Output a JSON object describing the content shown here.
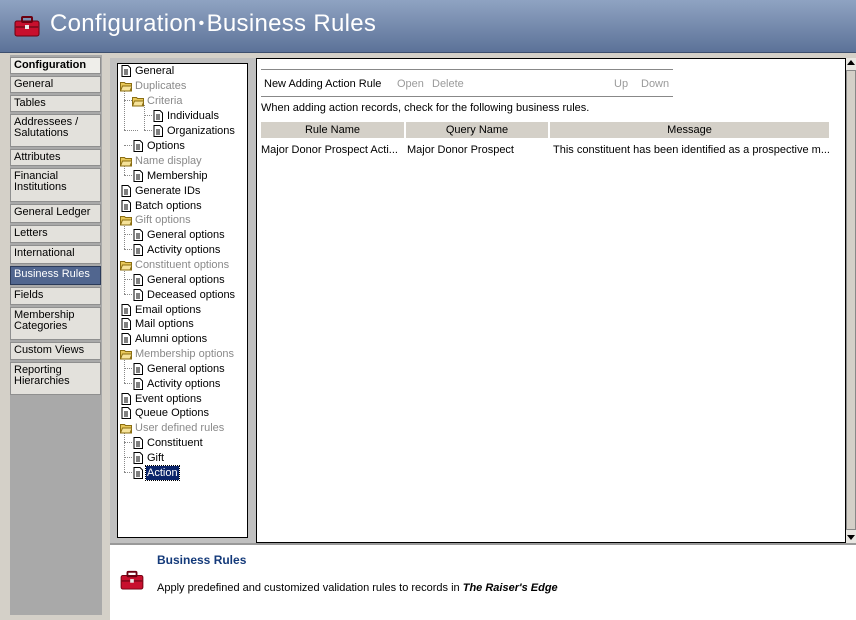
{
  "header": {
    "title_main": "Configuration",
    "separator": "•",
    "title_sub": "Business Rules",
    "icon": "toolbox-icon"
  },
  "nav": {
    "header_label": "Configuration",
    "items": [
      {
        "label": "General"
      },
      {
        "label": "Tables"
      },
      {
        "label": "Addressees / Salutations"
      },
      {
        "label": "Attributes"
      },
      {
        "label": "Financial Institutions"
      },
      {
        "label": "General Ledger"
      },
      {
        "label": "Letters"
      },
      {
        "label": "International"
      },
      {
        "label": "Business Rules",
        "active": true
      },
      {
        "label": "Fields"
      },
      {
        "label": "Membership Categories"
      },
      {
        "label": "Custom Views"
      },
      {
        "label": "Reporting Hierarchies"
      }
    ]
  },
  "tree": {
    "nodes": [
      {
        "label": "General",
        "icon": "page-icon"
      },
      {
        "label": "Duplicates",
        "icon": "folder-open-icon"
      },
      {
        "label": "Criteria",
        "icon": "folder-open-icon"
      },
      {
        "label": "Individuals",
        "icon": "page-icon"
      },
      {
        "label": "Organizations",
        "icon": "page-icon"
      },
      {
        "label": "Options",
        "icon": "page-icon"
      },
      {
        "label": "Name display",
        "icon": "folder-open-icon"
      },
      {
        "label": "Membership",
        "icon": "page-icon"
      },
      {
        "label": "Generate IDs",
        "icon": "page-icon"
      },
      {
        "label": "Batch options",
        "icon": "page-icon"
      },
      {
        "label": "Gift options",
        "icon": "folder-open-icon"
      },
      {
        "label": "General options",
        "icon": "page-icon"
      },
      {
        "label": "Activity options",
        "icon": "page-icon"
      },
      {
        "label": "Constituent options",
        "icon": "folder-open-icon"
      },
      {
        "label": "General options",
        "icon": "page-icon"
      },
      {
        "label": "Deceased options",
        "icon": "page-icon"
      },
      {
        "label": "Email options",
        "icon": "page-icon"
      },
      {
        "label": "Mail options",
        "icon": "page-icon"
      },
      {
        "label": "Alumni options",
        "icon": "page-icon"
      },
      {
        "label": "Membership options",
        "icon": "folder-open-icon"
      },
      {
        "label": "General options",
        "icon": "page-icon"
      },
      {
        "label": "Activity options",
        "icon": "page-icon"
      },
      {
        "label": "Event options",
        "icon": "page-icon"
      },
      {
        "label": "Queue Options",
        "icon": "page-icon"
      },
      {
        "label": "User defined rules",
        "icon": "folder-open-icon"
      },
      {
        "label": "Constituent",
        "icon": "page-icon"
      },
      {
        "label": "Gift",
        "icon": "page-icon"
      },
      {
        "label": "Action",
        "icon": "page-icon",
        "selected": true
      }
    ]
  },
  "actions": {
    "new_label": "New Adding Action Rule",
    "open_label": "Open",
    "delete_label": "Delete",
    "up_label": "Up",
    "down_label": "Down"
  },
  "instruction": "When adding action records, check for the following business rules.",
  "grid": {
    "columns": [
      "Rule Name",
      "Query Name",
      "Message"
    ],
    "rows": [
      [
        "Major Donor Prospect Acti...",
        "Major Donor Prospect",
        "This constituent has been identified as a prospective m..."
      ]
    ]
  },
  "footer": {
    "title": "Business Rules",
    "desc_prefix": "Apply predefined and customized validation rules to records in ",
    "desc_product": "The Raiser's Edge",
    "icon": "toolbox-icon"
  },
  "colors": {
    "header_bg": "#6f84a8",
    "nav_active": "#51668f",
    "footer_title": "#143a7a",
    "selection": "#0a246a"
  }
}
